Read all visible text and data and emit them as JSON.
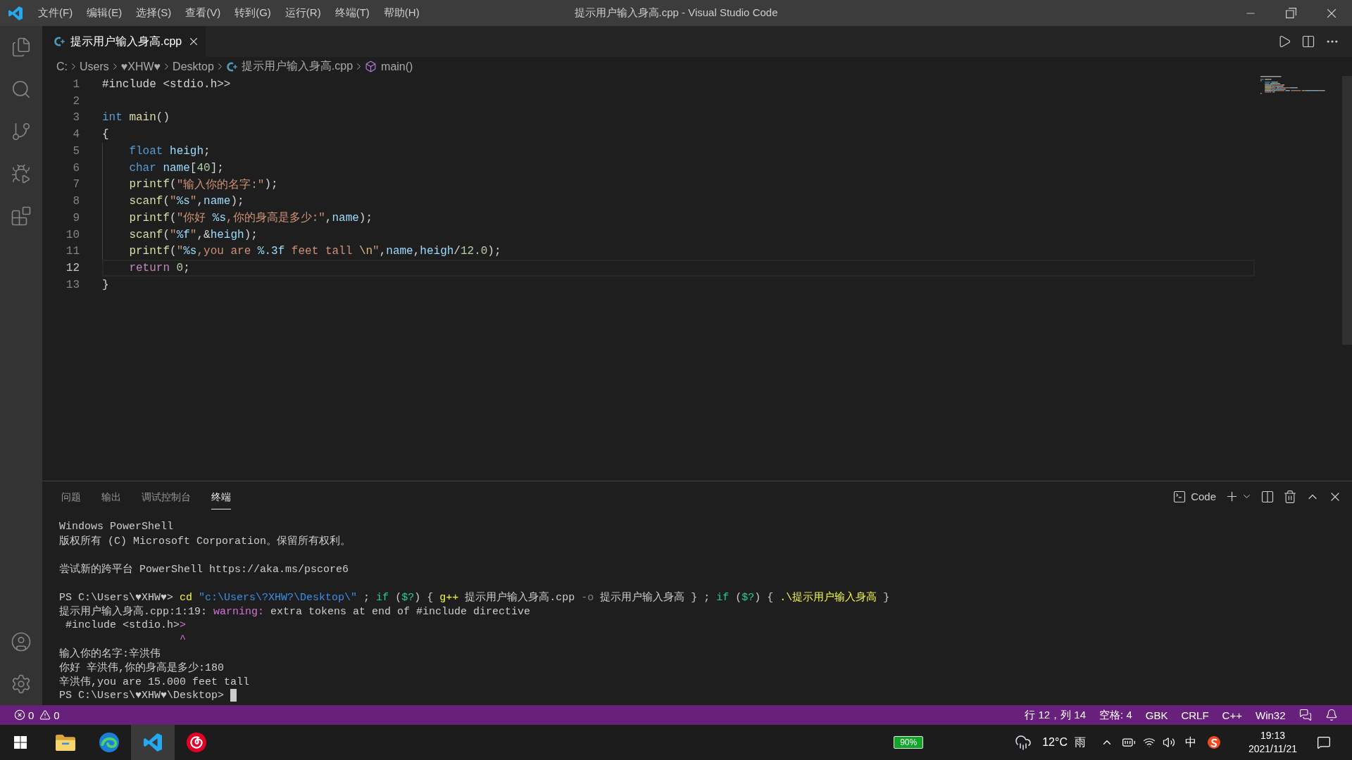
{
  "window": {
    "title": "提示用户输入身高.cpp - Visual Studio Code"
  },
  "menu": [
    "文件(F)",
    "编辑(E)",
    "选择(S)",
    "查看(V)",
    "转到(G)",
    "运行(R)",
    "终端(T)",
    "帮助(H)"
  ],
  "editor": {
    "tabs": [
      {
        "label": "提示用户输入身高.cpp",
        "selected": true
      }
    ],
    "breadcrumb": [
      {
        "kind": "folder",
        "label": "C:"
      },
      {
        "kind": "folder",
        "label": "Users"
      },
      {
        "kind": "folder",
        "label": "♥XHW♥"
      },
      {
        "kind": "folder",
        "label": "Desktop"
      },
      {
        "kind": "file",
        "label": "提示用户输入身高.cpp"
      },
      {
        "kind": "symbol",
        "label": "main()"
      }
    ],
    "lines": [
      {
        "number": "1",
        "current": false,
        "tokens": [
          {
            "kind": "plain",
            "text": "#include <stdio.h>>"
          }
        ]
      },
      {
        "number": "2",
        "current": false
      },
      {
        "number": "3",
        "current": false,
        "tokens": [
          {
            "kind": "type",
            "text": "int"
          },
          {
            "kind": "function",
            "text": " main"
          },
          {
            "kind": "plain",
            "text": "()"
          }
        ]
      },
      {
        "number": "4",
        "current": false,
        "tokens": [
          {
            "kind": "plain",
            "text": "{"
          }
        ],
        "children": [
          {
            "number": "5",
            "current": false,
            "tokens": [
              {
                "kind": "type",
                "text": "float"
              },
              {
                "kind": "variable",
                "text": " heigh"
              },
              {
                "kind": "plain",
                "text": ";"
              }
            ]
          },
          {
            "number": "6",
            "current": false,
            "tokens": [
              {
                "kind": "type",
                "text": "char"
              },
              {
                "kind": "variable",
                "text": " name"
              },
              {
                "kind": "plain",
                "text": "["
              },
              {
                "kind": "number",
                "text": "40"
              },
              {
                "kind": "plain",
                "text": "];"
              }
            ]
          },
          {
            "number": "7",
            "current": false,
            "tokens": [
              {
                "kind": "function",
                "text": "printf"
              },
              {
                "kind": "plain",
                "text": "("
              },
              {
                "kind": "string",
                "text": "\"输入你的名字:\""
              },
              {
                "kind": "plain",
                "text": ");"
              }
            ]
          },
          {
            "number": "8",
            "current": false,
            "tokens": [
              {
                "kind": "function",
                "text": "scanf"
              },
              {
                "kind": "plain",
                "text": "("
              },
              {
                "kind": "string",
                "text": "\""
              },
              {
                "kind": "format",
                "text": "%s"
              },
              {
                "kind": "string",
                "text": "\""
              },
              {
                "kind": "plain",
                "text": ","
              },
              {
                "kind": "variable",
                "text": "name"
              },
              {
                "kind": "plain",
                "text": ");"
              }
            ]
          },
          {
            "number": "9",
            "current": false,
            "tokens": [
              {
                "kind": "function",
                "text": "printf"
              },
              {
                "kind": "plain",
                "text": "("
              },
              {
                "kind": "string",
                "text": "\"你好 "
              },
              {
                "kind": "format",
                "text": "%s"
              },
              {
                "kind": "string",
                "text": ",你的身高是多少:\""
              },
              {
                "kind": "plain",
                "text": ","
              },
              {
                "kind": "variable",
                "text": "name"
              },
              {
                "kind": "plain",
                "text": ");"
              }
            ]
          },
          {
            "number": "10",
            "current": false,
            "tokens": [
              {
                "kind": "function",
                "text": "scanf"
              },
              {
                "kind": "plain",
                "text": "("
              },
              {
                "kind": "string",
                "text": "\""
              },
              {
                "kind": "format",
                "text": "%f"
              },
              {
                "kind": "string",
                "text": "\""
              },
              {
                "kind": "plain",
                "text": ",&"
              },
              {
                "kind": "variable",
                "text": "heigh"
              },
              {
                "kind": "plain",
                "text": ");"
              }
            ]
          },
          {
            "number": "11",
            "current": false,
            "tokens": [
              {
                "kind": "function",
                "text": "printf"
              },
              {
                "kind": "plain",
                "text": "("
              },
              {
                "kind": "string",
                "text": "\""
              },
              {
                "kind": "format",
                "text": "%s"
              },
              {
                "kind": "string",
                "text": ",you are "
              },
              {
                "kind": "format",
                "text": "%.3f"
              },
              {
                "kind": "string",
                "text": " feet tall "
              },
              {
                "kind": "escape",
                "text": "\\n"
              },
              {
                "kind": "string",
                "text": "\""
              },
              {
                "kind": "plain",
                "text": ","
              },
              {
                "kind": "variable",
                "text": "name"
              },
              {
                "kind": "plain",
                "text": ","
              },
              {
                "kind": "variable",
                "text": "heigh"
              },
              {
                "kind": "plain",
                "text": "/"
              },
              {
                "kind": "number",
                "text": "12.0"
              },
              {
                "kind": "plain",
                "text": ");"
              }
            ]
          },
          {
            "number": "12",
            "current": true,
            "tokens": [
              {
                "kind": "control",
                "text": "return"
              },
              {
                "kind": "number",
                "text": " 0"
              },
              {
                "kind": "plain",
                "text": ";"
              }
            ]
          }
        ]
      },
      {
        "number": "13",
        "current": false,
        "tokens": [
          {
            "kind": "plain",
            "text": "}"
          }
        ]
      }
    ]
  },
  "panel": {
    "tabs": [
      {
        "label": "问题",
        "selected": false
      },
      {
        "label": "输出",
        "selected": false
      },
      {
        "label": "调试控制台",
        "selected": false
      },
      {
        "label": "终端",
        "selected": true
      }
    ],
    "terminal_picker": "Code",
    "terminal": {
      "cursor": true,
      "blocks": [
        {
          "lines": [
            {
              "tokens": [
                {
                  "kind": "plain",
                  "text": "Windows PowerShell"
                }
              ]
            },
            {
              "tokens": [
                {
                  "kind": "plain",
                  "text": "版权所有 (C) Microsoft Corporation。保留所有权利。"
                }
              ]
            }
          ]
        },
        {
          "lines": [
            {
              "tokens": [
                {
                  "kind": "plain",
                  "text": "尝试新的跨平台 PowerShell https://aka.ms/pscore6"
                }
              ]
            }
          ]
        },
        {
          "lines": [
            {
              "tokens": [
                {
                  "kind": "plain",
                  "text": "PS C:\\Users\\♥XHW♥> "
                },
                {
                  "kind": "command",
                  "text": "cd"
                },
                {
                  "kind": "string",
                  "text": " \"c:\\Users\\?XHW?\\Desktop\\\""
                },
                {
                  "kind": "plain",
                  "text": " ; "
                },
                {
                  "kind": "keyword",
                  "text": "if"
                },
                {
                  "kind": "plain",
                  "text": " ("
                },
                {
                  "kind": "variable",
                  "text": "$?"
                },
                {
                  "kind": "plain",
                  "text": ") { "
                },
                {
                  "kind": "command",
                  "text": "g++"
                },
                {
                  "kind": "plain",
                  "text": " 提示用户输入身高.cpp "
                },
                {
                  "kind": "parameter",
                  "text": "-o"
                },
                {
                  "kind": "plain",
                  "text": " 提示用户输入身高 } ; "
                },
                {
                  "kind": "keyword",
                  "text": "if"
                },
                {
                  "kind": "plain",
                  "text": " ("
                },
                {
                  "kind": "variable",
                  "text": "$?"
                },
                {
                  "kind": "plain",
                  "text": ") { "
                },
                {
                  "kind": "command",
                  "text": ".\\提示用户输入身高"
                },
                {
                  "kind": "plain",
                  "text": " }"
                }
              ]
            },
            {
              "tokens": [
                {
                  "kind": "plain",
                  "text": "提示用户输入身高.cpp:1:19: "
                },
                {
                  "kind": "warning",
                  "text": "warning:"
                },
                {
                  "kind": "plain",
                  "text": " extra tokens at end of #include directive"
                }
              ]
            },
            {
              "tokens": [
                {
                  "kind": "plain",
                  "text": " #include <stdio.h>"
                },
                {
                  "kind": "warning",
                  "text": ">"
                }
              ]
            },
            {
              "tokens": [
                {
                  "kind": "warning",
                  "text": "                   ^"
                }
              ]
            },
            {
              "tokens": [
                {
                  "kind": "plain",
                  "text": "输入你的名字:辛洪伟"
                }
              ]
            },
            {
              "tokens": [
                {
                  "kind": "plain",
                  "text": "你好 辛洪伟,你的身高是多少:180"
                }
              ]
            },
            {
              "tokens": [
                {
                  "kind": "plain",
                  "text": "辛洪伟,you are 15.000 feet tall"
                }
              ]
            },
            {
              "tokens": [
                {
                  "kind": "plain",
                  "text": "PS C:\\Users\\♥XHW♥\\Desktop> "
                }
              ]
            }
          ]
        }
      ]
    }
  },
  "status_bar": {
    "errors": "0",
    "warnings": "0",
    "items": [
      "行 12，列 14",
      "空格: 4",
      "GBK",
      "CRLF",
      "C++",
      "Win32"
    ]
  },
  "taskbar": {
    "apps": [
      {
        "kind": "files",
        "selected": false
      },
      {
        "kind": "browser",
        "selected": false
      },
      {
        "kind": "editor",
        "selected": true
      },
      {
        "kind": "music",
        "selected": false
      }
    ],
    "battery_widget": "90%",
    "weather": {
      "temperature": "12°C",
      "condition": "雨"
    },
    "ime": "中",
    "clock": {
      "time": "19:13",
      "date": "2021/11/21"
    }
  }
}
